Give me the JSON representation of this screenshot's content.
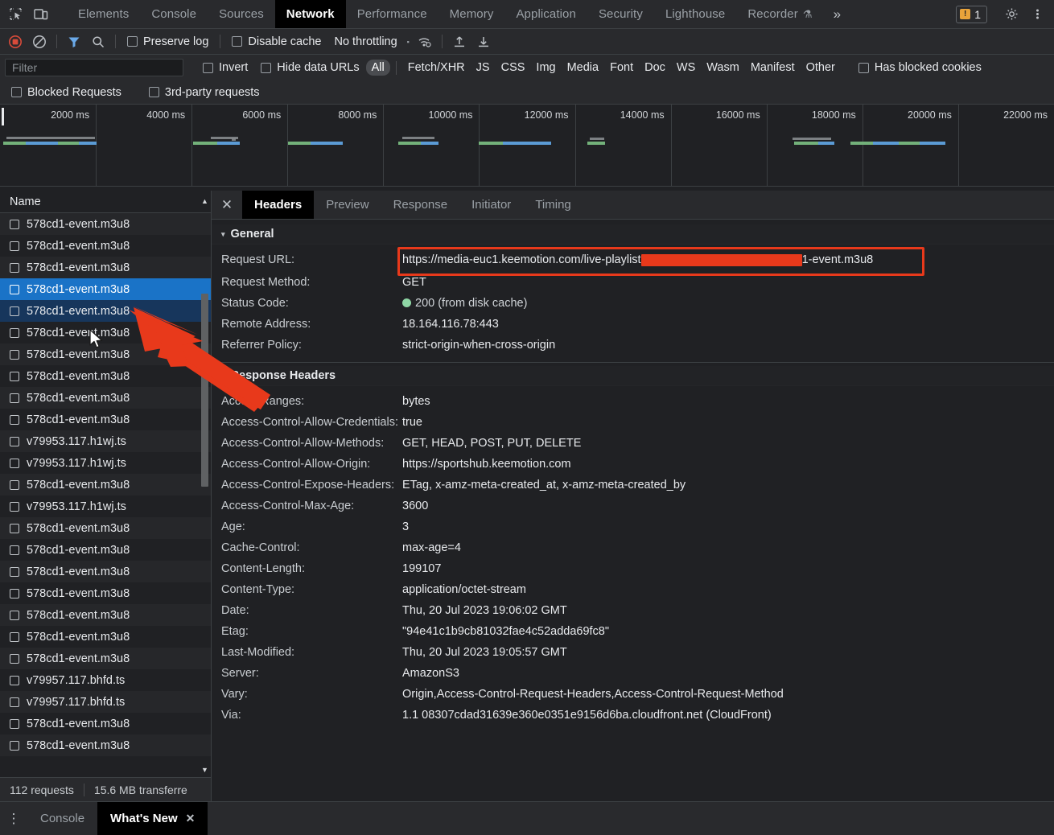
{
  "devtools": {
    "panel_tabs": [
      {
        "label": "Elements",
        "active": false
      },
      {
        "label": "Console",
        "active": false
      },
      {
        "label": "Sources",
        "active": false
      },
      {
        "label": "Network",
        "active": true
      },
      {
        "label": "Performance",
        "active": false
      },
      {
        "label": "Memory",
        "active": false
      },
      {
        "label": "Application",
        "active": false
      },
      {
        "label": "Security",
        "active": false
      },
      {
        "label": "Lighthouse",
        "active": false
      },
      {
        "label": "Recorder",
        "active": false,
        "flask": "⚗"
      }
    ],
    "more_tabs_label": "»",
    "warning_count": "1",
    "warning_glyph": "!",
    "inspect_icon": "inspect-element-icon",
    "device_icon": "device-toolbar-icon",
    "settings_icon": "gear-icon",
    "kebab_icon": "more-options-icon"
  },
  "network_toolbar": {
    "record_label": "record-button",
    "clear_label": "clear-button",
    "filter_toggle_label": "filter-toggle",
    "search_label": "search-button",
    "preserve_log": "Preserve log",
    "disable_cache": "Disable cache",
    "throttling": "No throttling",
    "throttle_caret": "▾",
    "wifi_icon": "network-conditions-icon",
    "import_icon": "import-har-icon",
    "export_icon": "export-har-icon"
  },
  "filter_bar": {
    "filter_placeholder": "Filter",
    "filter_value": "",
    "invert": "Invert",
    "hide_data_urls": "Hide data URLs",
    "types": [
      {
        "label": "All",
        "selected": true
      },
      {
        "label": "Fetch/XHR",
        "selected": false
      },
      {
        "label": "JS",
        "selected": false
      },
      {
        "label": "CSS",
        "selected": false
      },
      {
        "label": "Img",
        "selected": false
      },
      {
        "label": "Media",
        "selected": false
      },
      {
        "label": "Font",
        "selected": false
      },
      {
        "label": "Doc",
        "selected": false
      },
      {
        "label": "WS",
        "selected": false
      },
      {
        "label": "Wasm",
        "selected": false
      },
      {
        "label": "Manifest",
        "selected": false
      },
      {
        "label": "Other",
        "selected": false
      }
    ],
    "has_blocked_cookies": "Has blocked cookies",
    "blocked_requests": "Blocked Requests",
    "third_party_requests": "3rd-party requests"
  },
  "overview": {
    "ticks": [
      "2000 ms",
      "4000 ms",
      "6000 ms",
      "8000 ms",
      "10000 ms",
      "12000 ms",
      "14000 ms",
      "16000 ms",
      "18000 ms",
      "20000 ms",
      "22000 ms"
    ]
  },
  "request_list": {
    "column_header": "Name",
    "rows": [
      {
        "name": "578cd1-event.m3u8",
        "state": "normal"
      },
      {
        "name": "578cd1-event.m3u8",
        "state": "normal"
      },
      {
        "name": "578cd1-event.m3u8",
        "state": "normal"
      },
      {
        "name": "578cd1-event.m3u8",
        "state": "selected"
      },
      {
        "name": "578cd1-event.m3u8",
        "state": "hovered"
      },
      {
        "name": "578cd1-event.m3u8",
        "state": "normal"
      },
      {
        "name": "578cd1-event.m3u8",
        "state": "normal"
      },
      {
        "name": "578cd1-event.m3u8",
        "state": "normal"
      },
      {
        "name": "578cd1-event.m3u8",
        "state": "normal"
      },
      {
        "name": "578cd1-event.m3u8",
        "state": "normal"
      },
      {
        "name": "v79953.117.h1wj.ts",
        "state": "normal"
      },
      {
        "name": "v79953.117.h1wj.ts",
        "state": "normal"
      },
      {
        "name": "578cd1-event.m3u8",
        "state": "normal"
      },
      {
        "name": "v79953.117.h1wj.ts",
        "state": "normal"
      },
      {
        "name": "578cd1-event.m3u8",
        "state": "normal"
      },
      {
        "name": "578cd1-event.m3u8",
        "state": "normal"
      },
      {
        "name": "578cd1-event.m3u8",
        "state": "normal"
      },
      {
        "name": "578cd1-event.m3u8",
        "state": "normal"
      },
      {
        "name": "578cd1-event.m3u8",
        "state": "normal"
      },
      {
        "name": "578cd1-event.m3u8",
        "state": "normal"
      },
      {
        "name": "578cd1-event.m3u8",
        "state": "normal"
      },
      {
        "name": "v79957.117.bhfd.ts",
        "state": "normal"
      },
      {
        "name": "v79957.117.bhfd.ts",
        "state": "normal"
      },
      {
        "name": "578cd1-event.m3u8",
        "state": "normal"
      },
      {
        "name": "578cd1-event.m3u8",
        "state": "normal"
      }
    ]
  },
  "status_bar": {
    "requests": "112 requests",
    "transferred": "15.6 MB transferre"
  },
  "details": {
    "tabs": [
      {
        "label": "Headers",
        "active": true
      },
      {
        "label": "Preview",
        "active": false
      },
      {
        "label": "Response",
        "active": false
      },
      {
        "label": "Initiator",
        "active": false
      },
      {
        "label": "Timing",
        "active": false
      }
    ],
    "close_icon": "close-icon",
    "general_section": {
      "title": "General",
      "caret": "▾",
      "rows": [
        {
          "key": "Request URL:",
          "value_prefix": "https://media-euc1.keemotion.com/live-playlist",
          "redacted": true,
          "value_suffix": "1-event.m3u8",
          "highlighted": true
        },
        {
          "key": "Request Method:",
          "value": "GET"
        },
        {
          "key": "Status Code:",
          "value": "200 (from disk cache)",
          "status_dot": "#8fd6a5"
        },
        {
          "key": "Remote Address:",
          "value": "18.164.116.78:443"
        },
        {
          "key": "Referrer Policy:",
          "value": "strict-origin-when-cross-origin"
        }
      ]
    },
    "response_section": {
      "title": "Response Headers",
      "caret": "▾",
      "rows": [
        {
          "key": "Accept-Ranges:",
          "value": "bytes"
        },
        {
          "key": "Access-Control-Allow-Credentials:",
          "value": "true"
        },
        {
          "key": "Access-Control-Allow-Methods:",
          "value": "GET, HEAD, POST, PUT, DELETE"
        },
        {
          "key": "Access-Control-Allow-Origin:",
          "value": "https://sportshub.keemotion.com"
        },
        {
          "key": "Access-Control-Expose-Headers:",
          "value": "ETag, x-amz-meta-created_at, x-amz-meta-created_by"
        },
        {
          "key": "Access-Control-Max-Age:",
          "value": "3600"
        },
        {
          "key": "Age:",
          "value": "3"
        },
        {
          "key": "Cache-Control:",
          "value": "max-age=4"
        },
        {
          "key": "Content-Length:",
          "value": "199107"
        },
        {
          "key": "Content-Type:",
          "value": "application/octet-stream"
        },
        {
          "key": "Date:",
          "value": "Thu, 20 Jul 2023 19:06:02 GMT"
        },
        {
          "key": "Etag:",
          "value": "\"94e41c1b9cb81032fae4c52adda69fc8\""
        },
        {
          "key": "Last-Modified:",
          "value": "Thu, 20 Jul 2023 19:05:57 GMT"
        },
        {
          "key": "Server:",
          "value": "AmazonS3"
        },
        {
          "key": "Vary:",
          "value": "Origin,Access-Control-Request-Headers,Access-Control-Request-Method"
        },
        {
          "key": "Via:",
          "value": "1.1 08307cdad31639e360e0351e9156d6ba.cloudfront.net (CloudFront)"
        }
      ]
    }
  },
  "drawer": {
    "kebab": "⋮",
    "tabs": [
      {
        "label": "Console",
        "active": false,
        "closable": false
      },
      {
        "label": "What's New",
        "active": true,
        "closable": true
      }
    ],
    "close_glyph": "✕"
  },
  "annotations": {
    "arrow_color": "#e8391b",
    "highlight_color": "#e8391b"
  }
}
